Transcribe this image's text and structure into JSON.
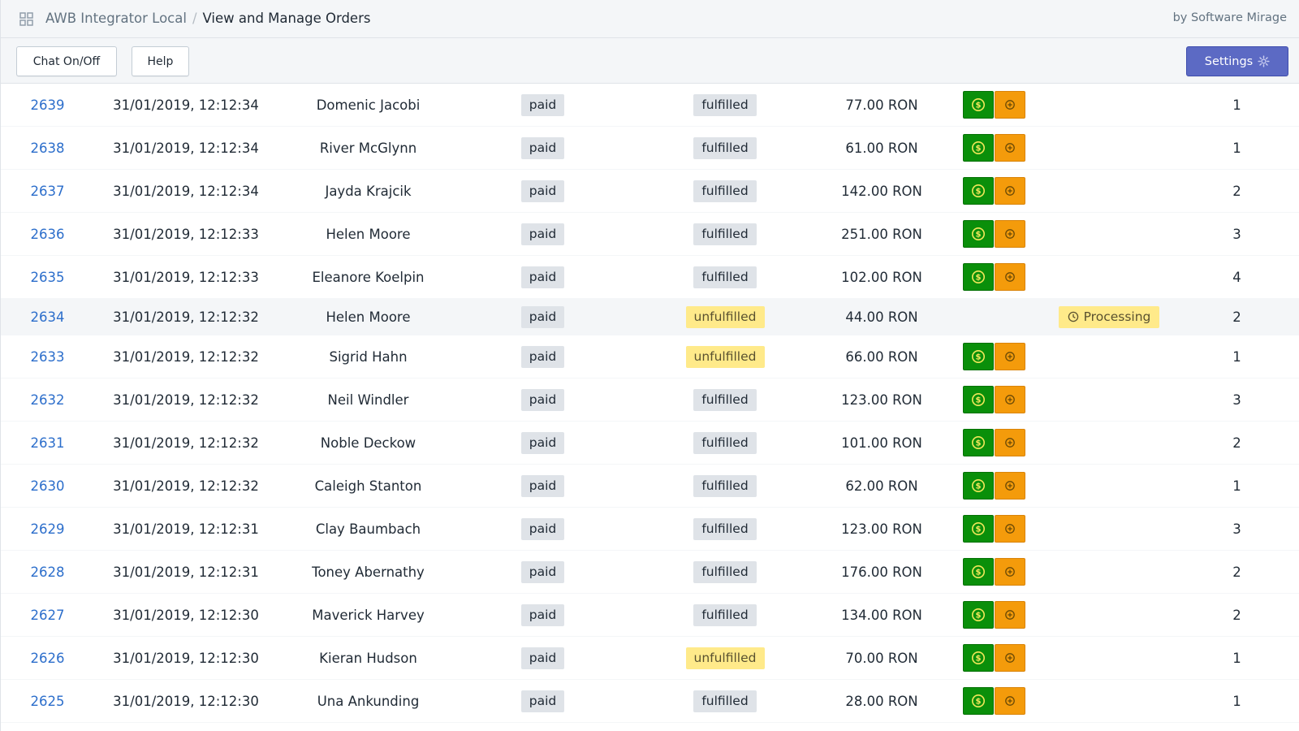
{
  "header": {
    "app_name": "AWB Integrator Local",
    "separator": "/",
    "page_title": "View and Manage Orders",
    "byline": "by Software Mirage"
  },
  "toolbar": {
    "chat_label": "Chat On/Off",
    "help_label": "Help",
    "settings_label": "Settings"
  },
  "colors": {
    "link": "#2c6ecb",
    "primary": "#5c6ac4",
    "money_action": "#0a8f0a",
    "plus_action": "#f49b0b",
    "warning_badge": "#ffea8a"
  },
  "icons": {
    "app": "apps-grid-icon",
    "settings": "gear-icon",
    "money_action": "dollar-circle-icon",
    "plus_action": "plus-circle-icon",
    "processing": "clock-icon"
  },
  "orders": [
    {
      "id": "2639",
      "date": "31/01/2019, 12:12:34",
      "customer": "Domenic Jacobi",
      "payment": "paid",
      "fulfillment": "fulfilled",
      "total": "77.00 RON",
      "status": "",
      "qty": "1"
    },
    {
      "id": "2638",
      "date": "31/01/2019, 12:12:34",
      "customer": "River McGlynn",
      "payment": "paid",
      "fulfillment": "fulfilled",
      "total": "61.00 RON",
      "status": "",
      "qty": "1"
    },
    {
      "id": "2637",
      "date": "31/01/2019, 12:12:34",
      "customer": "Jayda Krajcik",
      "payment": "paid",
      "fulfillment": "fulfilled",
      "total": "142.00 RON",
      "status": "",
      "qty": "2"
    },
    {
      "id": "2636",
      "date": "31/01/2019, 12:12:33",
      "customer": "Helen Moore",
      "payment": "paid",
      "fulfillment": "fulfilled",
      "total": "251.00 RON",
      "status": "",
      "qty": "3"
    },
    {
      "id": "2635",
      "date": "31/01/2019, 12:12:33",
      "customer": "Eleanore Koelpin",
      "payment": "paid",
      "fulfillment": "fulfilled",
      "total": "102.00 RON",
      "status": "",
      "qty": "4"
    },
    {
      "id": "2634",
      "date": "31/01/2019, 12:12:32",
      "customer": "Helen Moore",
      "payment": "paid",
      "fulfillment": "unfulfilled",
      "total": "44.00 RON",
      "status": "Processing",
      "qty": "2"
    },
    {
      "id": "2633",
      "date": "31/01/2019, 12:12:32",
      "customer": "Sigrid Hahn",
      "payment": "paid",
      "fulfillment": "unfulfilled",
      "total": "66.00 RON",
      "status": "",
      "qty": "1"
    },
    {
      "id": "2632",
      "date": "31/01/2019, 12:12:32",
      "customer": "Neil Windler",
      "payment": "paid",
      "fulfillment": "fulfilled",
      "total": "123.00 RON",
      "status": "",
      "qty": "3"
    },
    {
      "id": "2631",
      "date": "31/01/2019, 12:12:32",
      "customer": "Noble Deckow",
      "payment": "paid",
      "fulfillment": "fulfilled",
      "total": "101.00 RON",
      "status": "",
      "qty": "2"
    },
    {
      "id": "2630",
      "date": "31/01/2019, 12:12:32",
      "customer": "Caleigh Stanton",
      "payment": "paid",
      "fulfillment": "fulfilled",
      "total": "62.00 RON",
      "status": "",
      "qty": "1"
    },
    {
      "id": "2629",
      "date": "31/01/2019, 12:12:31",
      "customer": "Clay Baumbach",
      "payment": "paid",
      "fulfillment": "fulfilled",
      "total": "123.00 RON",
      "status": "",
      "qty": "3"
    },
    {
      "id": "2628",
      "date": "31/01/2019, 12:12:31",
      "customer": "Toney Abernathy",
      "payment": "paid",
      "fulfillment": "fulfilled",
      "total": "176.00 RON",
      "status": "",
      "qty": "2"
    },
    {
      "id": "2627",
      "date": "31/01/2019, 12:12:30",
      "customer": "Maverick Harvey",
      "payment": "paid",
      "fulfillment": "fulfilled",
      "total": "134.00 RON",
      "status": "",
      "qty": "2"
    },
    {
      "id": "2626",
      "date": "31/01/2019, 12:12:30",
      "customer": "Kieran Hudson",
      "payment": "paid",
      "fulfillment": "unfulfilled",
      "total": "70.00 RON",
      "status": "",
      "qty": "1"
    },
    {
      "id": "2625",
      "date": "31/01/2019, 12:12:30",
      "customer": "Una Ankunding",
      "payment": "paid",
      "fulfillment": "fulfilled",
      "total": "28.00 RON",
      "status": "",
      "qty": "1"
    }
  ]
}
